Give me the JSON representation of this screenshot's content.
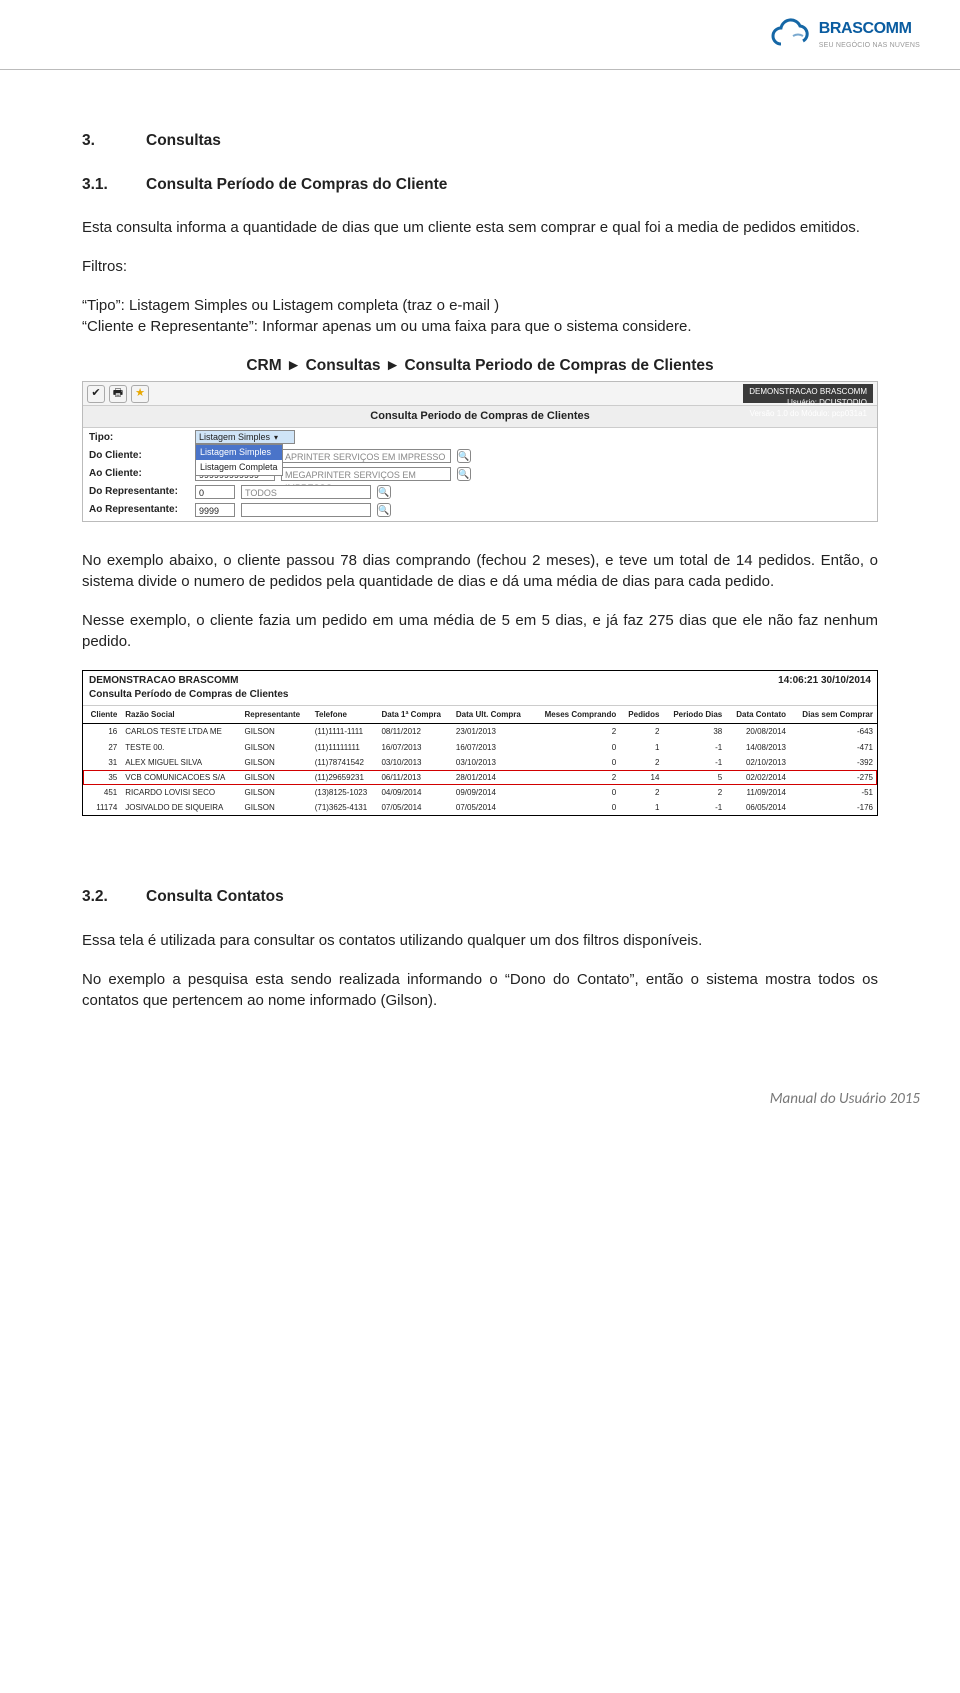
{
  "brand": {
    "name": "BRASCOMM",
    "tagline": "SEU NEGÓCIO NAS NUVENS"
  },
  "footer": "Manual do Usuário 2015",
  "section3": {
    "num": "3.",
    "title": "Consultas",
    "s31": {
      "num": "3.1.",
      "title": "Consulta Período de Compras do Cliente",
      "p1": "Esta consulta informa a quantidade de dias que um cliente esta sem comprar e qual foi a media de pedidos emitidos.",
      "filtersHeading": "Filtros:",
      "pFiltros1": "“Tipo”: Listagem Simples ou Listagem completa (traz o e-mail )",
      "pFiltros2": "“Cliente e Representante”: Informar apenas um ou uma faixa para que o sistema considere.",
      "breadcrumb": "CRM ► Consultas ► Consulta Periodo de Compras de Clientes",
      "p2": "No exemplo abaixo, o cliente passou 78 dias comprando (fechou 2 meses), e teve um total de 14 pedidos. Então, o sistema divide o numero de pedidos pela quantidade de dias e dá uma média de dias para cada pedido.",
      "p3": "Nesse exemplo, o cliente fazia um pedido em uma média de 5 em 5 dias, e já faz 275 dias que ele não faz nenhum pedido."
    },
    "s32": {
      "num": "3.2.",
      "title": "Consulta Contatos",
      "p1": "Essa tela é utilizada para consultar os contatos utilizando qualquer um dos filtros disponíveis.",
      "p2": "No exemplo a pesquisa esta sendo realizada informando o “Dono do Contato”, então o sistema mostra todos os contatos que pertencem ao nome informado (Gilson)."
    }
  },
  "shotA": {
    "sysRight": {
      "l1": "DEMONSTRACAO BRASCOMM",
      "l2": "Usuário: DCUSTODIO",
      "l3": "Versão 1.0 do Módulo: pcp031a1"
    },
    "title": "Consulta Periodo de Compras de Clientes",
    "labels": {
      "tipo": "Tipo:",
      "doCliente": "Do Cliente:",
      "aoCliente": "Ao Cliente:",
      "doRep": "Do Representante:",
      "aoRep": "Ao Representante:"
    },
    "values": {
      "tipoSelected": "Listagem Simples",
      "tipoOption2": "Listagem Completa",
      "doClienteDescr": "APRINTER SERVIÇOS EM IMPRESSO",
      "aoClienteCode": "999999999999",
      "aoClienteDescr": "MEGAPRINTER SERVIÇOS EM IMPRESSO",
      "doRepCode": "0",
      "doRepDescr": "TODOS",
      "aoRepCode": "9999"
    }
  },
  "shotB": {
    "header": {
      "l1": "DEMONSTRACAO BRASCOMM",
      "l2": "Consulta Período de Compras de Clientes",
      "timestamp": "14:06:21 30/10/2014"
    },
    "columns": [
      "Cliente",
      "Razão Social",
      "Representante",
      "Telefone",
      "Data 1ª Compra",
      "Data Ult. Compra",
      "Meses Comprando",
      "Pedidos",
      "Periodo Dias",
      "Data Contato",
      "Dias sem Comprar"
    ],
    "rows": [
      {
        "cliente": "16",
        "razao": "CARLOS TESTE LTDA ME",
        "rep": "GILSON",
        "tel": "(11)1111-1111",
        "d1": "08/11/2012",
        "du": "23/01/2013",
        "meses": "2",
        "ped": "2",
        "per": "38",
        "dc": "20/08/2014",
        "dsc": "-643"
      },
      {
        "cliente": "27",
        "razao": "TESTE 00.",
        "rep": "GILSON",
        "tel": "(11)11111111",
        "d1": "16/07/2013",
        "du": "16/07/2013",
        "meses": "0",
        "ped": "1",
        "per": "-1",
        "dc": "14/08/2013",
        "dsc": "-471"
      },
      {
        "cliente": "31",
        "razao": "ALEX MIGUEL SILVA",
        "rep": "GILSON",
        "tel": "(11)78741542",
        "d1": "03/10/2013",
        "du": "03/10/2013",
        "meses": "0",
        "ped": "2",
        "per": "-1",
        "dc": "02/10/2013",
        "dsc": "-392"
      },
      {
        "cliente": "35",
        "razao": "VCB COMUNICACOES S/A",
        "rep": "GILSON",
        "tel": "(11)29659231",
        "d1": "06/11/2013",
        "du": "28/01/2014",
        "meses": "2",
        "ped": "14",
        "per": "5",
        "dc": "02/02/2014",
        "dsc": "-275",
        "highlight": true
      },
      {
        "cliente": "451",
        "razao": "RICARDO LOVISI SECO",
        "rep": "GILSON",
        "tel": "(13)8125-1023",
        "d1": "04/09/2014",
        "du": "09/09/2014",
        "meses": "0",
        "ped": "2",
        "per": "2",
        "dc": "11/09/2014",
        "dsc": "-51"
      },
      {
        "cliente": "11174",
        "razao": "JOSIVALDO DE SIQUEIRA",
        "rep": "GILSON",
        "tel": "(71)3625-4131",
        "d1": "07/05/2014",
        "du": "07/05/2014",
        "meses": "0",
        "ped": "1",
        "per": "-1",
        "dc": "06/05/2014",
        "dsc": "-176"
      }
    ]
  }
}
